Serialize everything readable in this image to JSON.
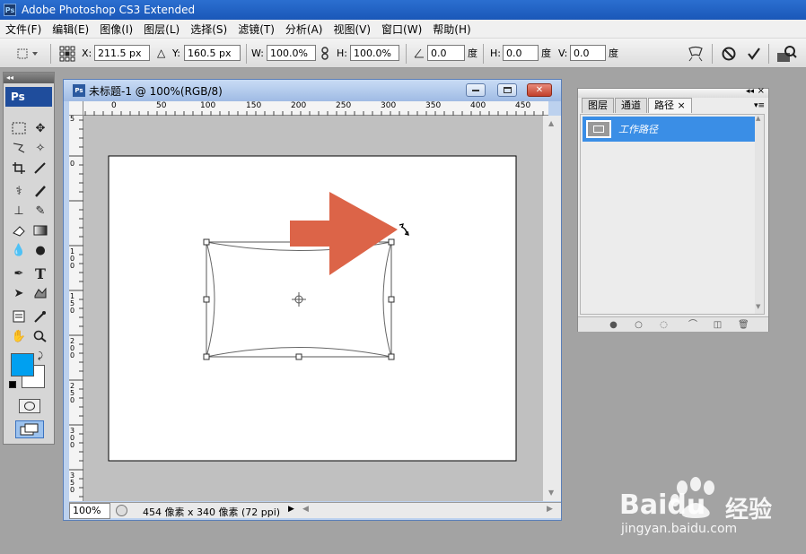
{
  "app": {
    "title": "Adobe Photoshop CS3 Extended",
    "logo": "Ps"
  },
  "menu": [
    "文件(F)",
    "编辑(E)",
    "图像(I)",
    "图层(L)",
    "选择(S)",
    "滤镜(T)",
    "分析(A)",
    "视图(V)",
    "窗口(W)",
    "帮助(H)"
  ],
  "options": {
    "x_label": "X:",
    "x_value": "211.5 px",
    "y_label": "Y:",
    "y_value": "160.5 px",
    "w_label": "W:",
    "w_value": "100.0%",
    "h_label": "H:",
    "h_value": "100.0%",
    "angle_value": "0.0",
    "angle_unit": "度",
    "skew_h_label": "H:",
    "skew_h_value": "0.0",
    "skew_h_unit": "度",
    "skew_v_label": "V:",
    "skew_v_value": "0.0",
    "skew_v_unit": "度"
  },
  "tools": {
    "logo": "Ps",
    "fg_color": "#00a0f0",
    "bg_color": "#ffffff"
  },
  "document": {
    "title": "未标题-1 @ 100%(RGB/8)",
    "icon_label": "Ps",
    "zoom": "100%",
    "status": "454 像素 x 340 像素 (72 ppi)",
    "ruler_top_labels": [
      "0",
      "50",
      "100",
      "150",
      "200",
      "250",
      "300",
      "350",
      "400",
      "450"
    ],
    "ruler_left_labels": [
      "5",
      "0",
      "1 0 0",
      "1 5 0",
      "2 0 0",
      "2 5 0",
      "3 0 0",
      "3 5 0"
    ]
  },
  "annotation": {
    "arrow_color": "#dc6448"
  },
  "paths_panel": {
    "tabs": [
      "图层",
      "通道",
      "路径"
    ],
    "active_tab": "路径",
    "close_glyph": "×",
    "path_name": "工作路径"
  },
  "watermark": {
    "brand": "Baidu",
    "cn": "经验",
    "url": "jingyan.baidu.com"
  }
}
